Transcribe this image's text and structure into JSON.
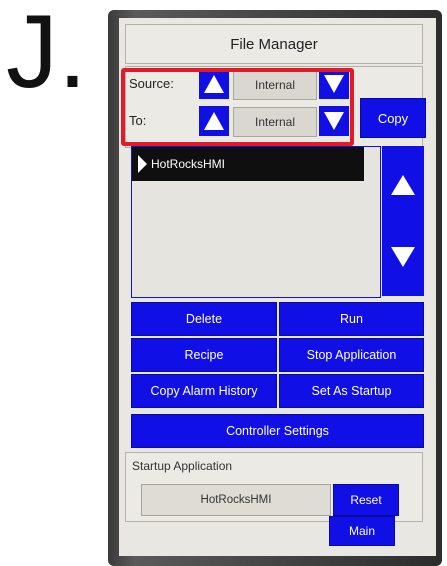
{
  "step_letter": "J.",
  "title": "File Manager",
  "source": {
    "label": "Source:",
    "value": "Internal"
  },
  "destination": {
    "label": "To:",
    "value": "Internal"
  },
  "copy_label": "Copy",
  "file_list": {
    "items": [
      "HotRocksHMI"
    ],
    "selected_index": 0
  },
  "buttons": {
    "delete": "Delete",
    "run": "Run",
    "recipe": "Recipe",
    "stop_application": "Stop Application",
    "copy_alarm_history": "Copy Alarm History",
    "set_as_startup": "Set As Startup",
    "controller_settings": "Controller Settings",
    "reset": "Reset",
    "main": "Main"
  },
  "startup": {
    "label": "Startup Application",
    "value": "HotRocksHMI"
  },
  "colors": {
    "button_blue": "#1010e6",
    "highlight_red": "#e01b2a",
    "screen_bg": "#e9e7e1"
  },
  "icons": {
    "up": "triangle-up-icon",
    "down": "triangle-down-icon",
    "list_marker": "triangle-right-icon"
  }
}
